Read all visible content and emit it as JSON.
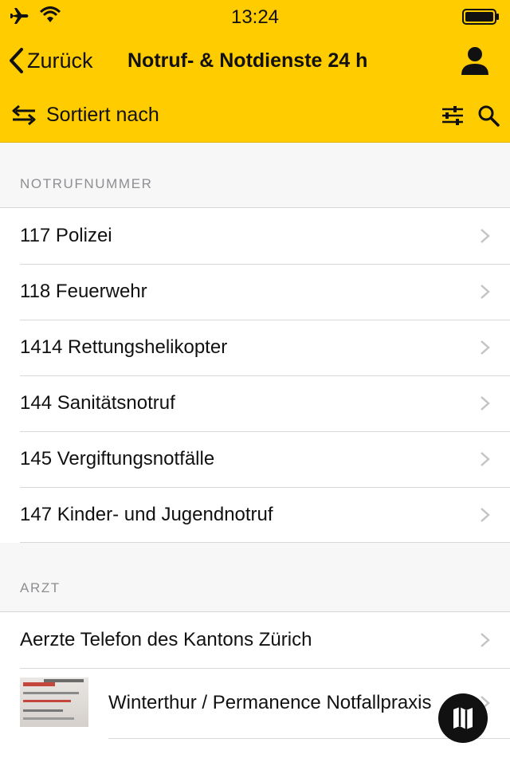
{
  "status_bar": {
    "time": "13:24"
  },
  "nav": {
    "back_label": "Zurück",
    "title": "Notruf- & Notdienste 24 h"
  },
  "toolbar": {
    "sort_label": "Sortiert nach"
  },
  "sections": [
    {
      "header": "NOTRUFNUMMER",
      "items": [
        "117 Polizei",
        "118 Feuerwehr",
        "1414 Rettungshelikopter",
        "144 Sanitätsnotruf",
        "145 Vergiftungsnotfälle",
        "147 Kinder- und Jugendnotruf"
      ]
    },
    {
      "header": "ARZT",
      "items": [
        "Aerzte Telefon des Kantons Zürich",
        "Winterthur / Permanence Notfallpraxis"
      ]
    }
  ],
  "colors": {
    "accent": "#ffcc00",
    "background": "#f7f7f7"
  }
}
